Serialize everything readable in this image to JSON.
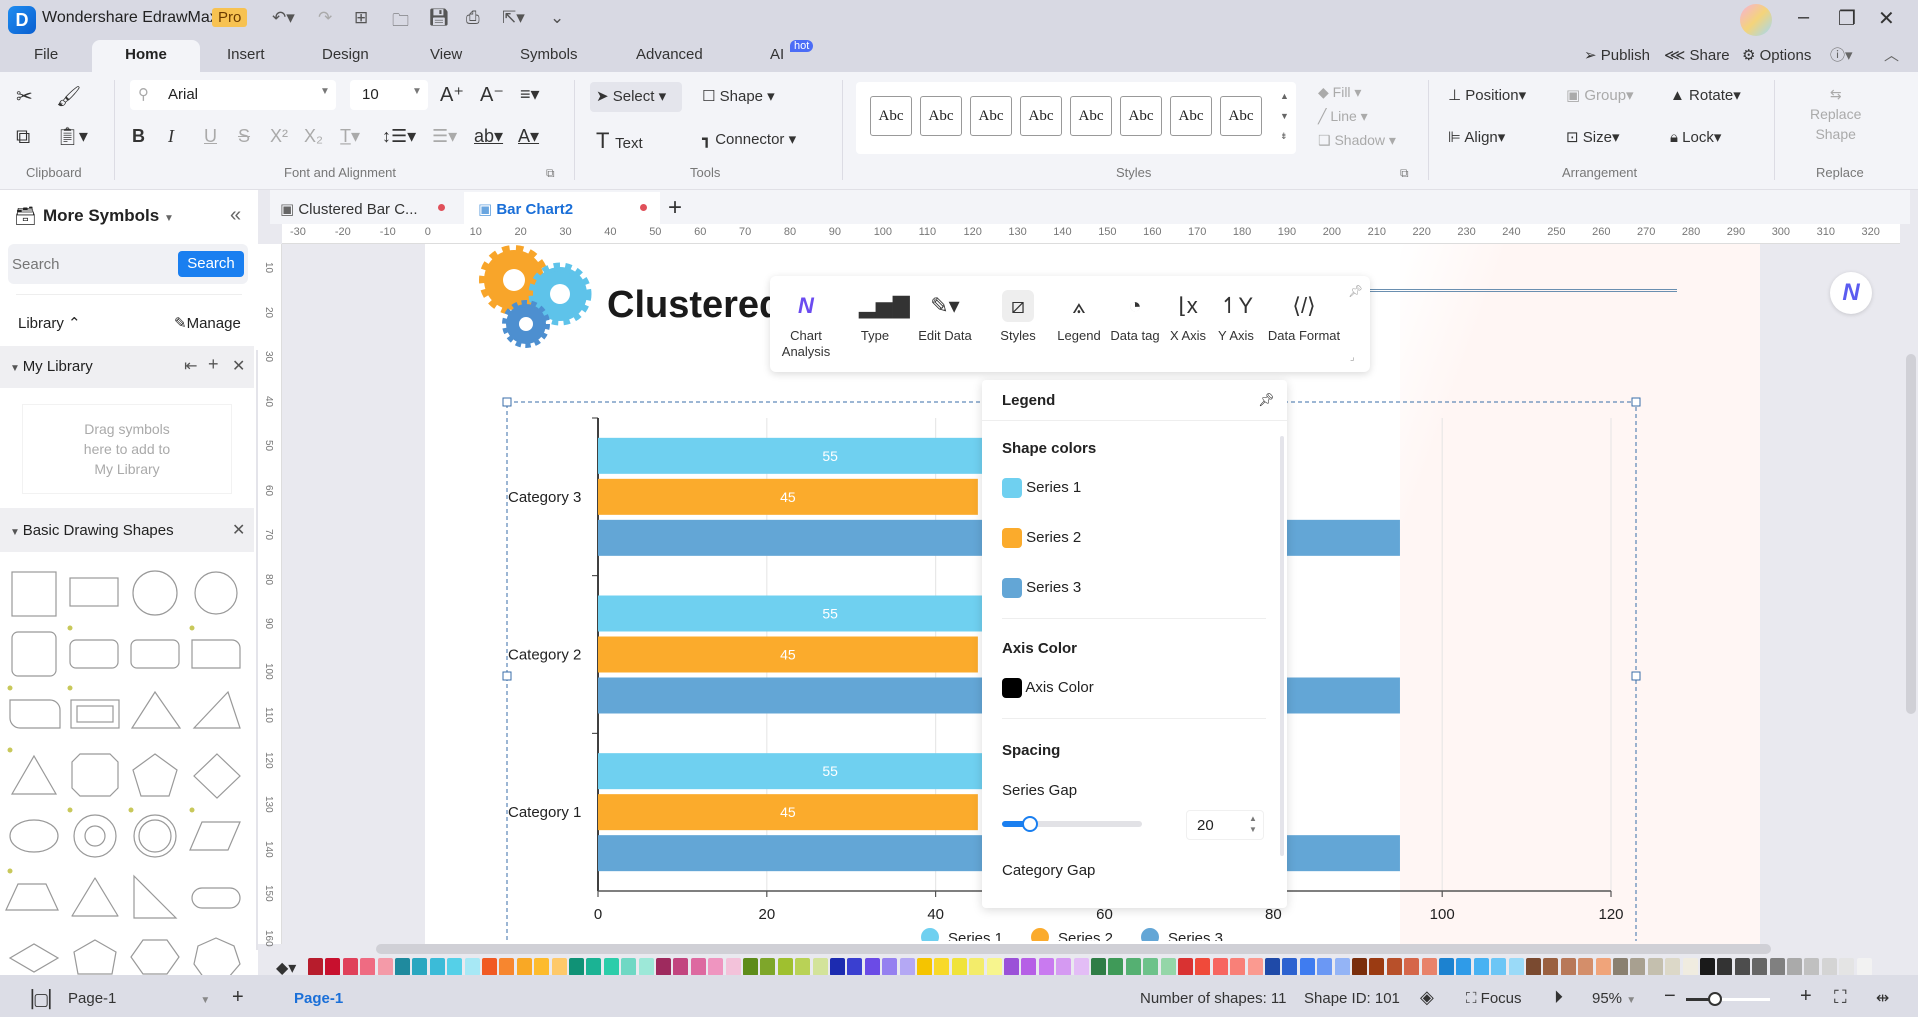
{
  "app": {
    "title": "Wondershare EdrawMax",
    "badge": "Pro"
  },
  "window_controls": {
    "minimize": "–",
    "restore": "❐",
    "close": "✕"
  },
  "menu": {
    "items": [
      "File",
      "Home",
      "Insert",
      "Design",
      "View",
      "Symbols",
      "Advanced",
      "AI"
    ],
    "ai_badge": "hot",
    "right": {
      "publish": "Publish",
      "share": "Share",
      "options": "Options"
    }
  },
  "ribbon": {
    "clipboard_label": "Clipboard",
    "font_label": "Font and Alignment",
    "tools_label": "Tools",
    "styles_label": "Styles",
    "arrangement_label": "Arrangement",
    "replace_label": "Replace",
    "font_family": "Arial",
    "font_size": "10",
    "select": "Select",
    "shape": "Shape",
    "text": "Text",
    "connector": "Connector",
    "style_swatch": "Abc",
    "fill": "Fill",
    "line": "Line",
    "shadow": "Shadow",
    "position": "Position",
    "group": "Group",
    "rotate": "Rotate",
    "align": "Align",
    "size": "Size",
    "lock": "Lock",
    "replace_shape_1": "Replace",
    "replace_shape_2": "Shape"
  },
  "sidebar": {
    "title": "More Symbols",
    "search_placeholder": "Search",
    "search_button": "Search",
    "library": "Library",
    "manage": "Manage",
    "my_library": "My Library",
    "drop_hint_1": "Drag symbols",
    "drop_hint_2": "here to add to",
    "drop_hint_3": "My Library",
    "basic_shapes": "Basic Drawing Shapes"
  },
  "tabs": [
    {
      "label": "Clustered Bar C...",
      "active": false
    },
    {
      "label": "Bar Chart2",
      "active": true
    }
  ],
  "ruler_h": [
    "-30",
    "-20",
    "-10",
    "0",
    "10",
    "20",
    "30",
    "40",
    "50",
    "60",
    "70",
    "80",
    "90",
    "100",
    "110",
    "120",
    "130",
    "140",
    "150",
    "160",
    "170",
    "180",
    "190",
    "200",
    "210",
    "220",
    "230",
    "240",
    "250",
    "260",
    "270",
    "280",
    "290",
    "300",
    "310",
    "320"
  ],
  "ruler_v": [
    "10",
    "20",
    "30",
    "40",
    "50",
    "60",
    "70",
    "80",
    "90",
    "100",
    "110",
    "120",
    "130",
    "140",
    "150",
    "160"
  ],
  "chart_title_visible": "Clustered",
  "chart_toolbar": [
    "Chart Analysis",
    "Type",
    "Edit Data",
    "Styles",
    "Legend",
    "Data tag",
    "X Axis",
    "Y Axis",
    "Data Format"
  ],
  "legend_panel": {
    "title": "Legend",
    "shape_colors": "Shape colors",
    "series": [
      {
        "name": "Series 1",
        "color": "#6fd0f0"
      },
      {
        "name": "Series 2",
        "color": "#fbab2c"
      },
      {
        "name": "Series 3",
        "color": "#63a6d6"
      }
    ],
    "axis_color_head": "Axis Color",
    "axis_color_label": "Axis Color",
    "axis_color": "#000000",
    "spacing": "Spacing",
    "series_gap_label": "Series Gap",
    "series_gap": "20",
    "series_gap_fraction": 0.2,
    "category_gap_label": "Category Gap"
  },
  "chart_data": {
    "type": "bar",
    "orientation": "horizontal",
    "categories": [
      "Category 1",
      "Category 2",
      "Category 3"
    ],
    "series": [
      {
        "name": "Series 1",
        "values": [
          55,
          55,
          55
        ],
        "color": "#6fd0f0"
      },
      {
        "name": "Series 2",
        "values": [
          45,
          45,
          45
        ],
        "color": "#fbab2c"
      },
      {
        "name": "Series 3",
        "values": [
          95,
          95,
          95
        ],
        "color": "#63a6d6"
      }
    ],
    "data_labels": {
      "Series 1": "55",
      "Series 2": "45"
    },
    "xlim": [
      0,
      120
    ],
    "xticks": [
      "0",
      "20",
      "40",
      "60",
      "80",
      "100",
      "120"
    ],
    "grid": true,
    "legend": "bottom"
  },
  "palette": [
    "#b71c2c",
    "#c8102e",
    "#e0405a",
    "#ef6b82",
    "#f49aa8",
    "#1f8a9e",
    "#2aa7c0",
    "#3bbbd8",
    "#55d0e8",
    "#a7e8f5",
    "#f15a24",
    "#f7862f",
    "#f9a825",
    "#fdbb2d",
    "#fec96a",
    "#109276",
    "#1bb394",
    "#2ccdaa",
    "#6fd8c4",
    "#9de8d8",
    "#9e2a5e",
    "#c2457f",
    "#dd69a0",
    "#ef95c0",
    "#f3c2da",
    "#5e8c1a",
    "#7ea62a",
    "#9fc02f",
    "#b9d256",
    "#d3e39a",
    "#1c2bb0",
    "#3a3fd0",
    "#6b4be6",
    "#9580f0",
    "#b4a8f4",
    "#f5c400",
    "#f8d92a",
    "#f0e33a",
    "#f3ec6a",
    "#f7f58e",
    "#9b51d8",
    "#b65fe6",
    "#c97af0",
    "#d59af2",
    "#e3bdf6",
    "#2f7d46",
    "#3f9a58",
    "#55b072",
    "#6dc28a",
    "#94d6a8",
    "#d93232",
    "#f04a3a",
    "#f76560",
    "#f98078",
    "#fb9a90",
    "#1f4aa8",
    "#2d62d0",
    "#3f7cf0",
    "#6b98f4",
    "#94b4f6",
    "#7a2e0c",
    "#9b3b12",
    "#b8502a",
    "#d5664a",
    "#e8826a",
    "#1c82d0",
    "#2f9be8",
    "#48b2f2",
    "#6cc6f6",
    "#9adaf8",
    "#7a4a30",
    "#9a6040",
    "#b87858",
    "#d48e6a",
    "#f0a47a",
    "#8a8070",
    "#a8a090",
    "#c4bfae",
    "#dcd8c8",
    "#f0ece0",
    "#1a1a1a",
    "#333333",
    "#4d4d4d",
    "#666666",
    "#808080",
    "#aaaaaa",
    "#c0c0c0",
    "#d4d4d4",
    "#e4e4e4",
    "#f2f2f2"
  ],
  "status": {
    "page_selector": "Page-1",
    "page_tab": "Page-1",
    "shapes": "Number of shapes: 11",
    "shape_id": "Shape ID: 101",
    "focus": "Focus",
    "zoom": "95%",
    "zoom_fraction": 0.35
  }
}
